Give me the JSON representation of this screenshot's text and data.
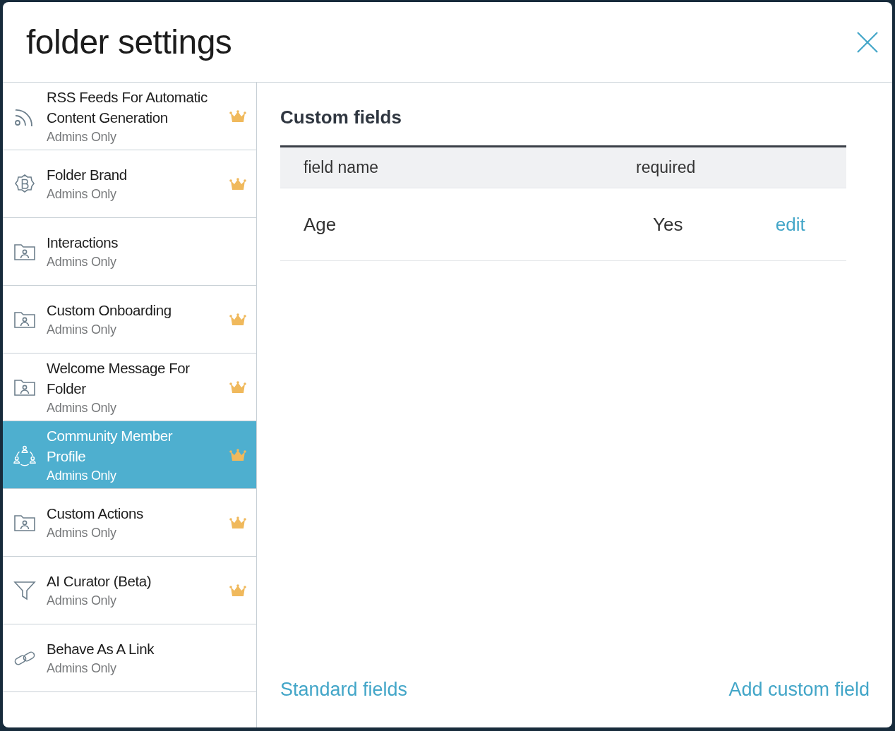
{
  "dialog": {
    "title": "folder settings"
  },
  "sidebar": {
    "items": [
      {
        "kind": "rss",
        "title": "RSS Feeds For Automatic Content Generation",
        "subtitle": "Admins Only",
        "premium": true,
        "selected": false
      },
      {
        "kind": "badge",
        "title": "Folder Brand",
        "subtitle": "Admins Only",
        "premium": true,
        "selected": false
      },
      {
        "kind": "folder-person",
        "title": "Interactions",
        "subtitle": "Admins Only",
        "premium": false,
        "selected": false
      },
      {
        "kind": "folder-person",
        "title": "Custom Onboarding",
        "subtitle": "Admins Only",
        "premium": true,
        "selected": false
      },
      {
        "kind": "folder-person",
        "title": "Welcome Message For Folder",
        "subtitle": "Admins Only",
        "premium": true,
        "selected": false
      },
      {
        "kind": "community",
        "title": "Community Member Profile",
        "subtitle": "Admins Only",
        "premium": true,
        "selected": true
      },
      {
        "kind": "folder-person",
        "title": "Custom Actions",
        "subtitle": "Admins Only",
        "premium": true,
        "selected": false
      },
      {
        "kind": "funnel",
        "title": "AI Curator (Beta)",
        "subtitle": "Admins Only",
        "premium": true,
        "selected": false
      },
      {
        "kind": "link",
        "title": "Behave As A Link",
        "subtitle": "Admins Only",
        "premium": false,
        "selected": false
      }
    ]
  },
  "content": {
    "heading": "Custom fields",
    "table": {
      "columns": [
        "field name",
        "required"
      ],
      "rows": [
        {
          "field_name": "Age",
          "required": "Yes",
          "action": "edit"
        }
      ]
    },
    "footer_links": [
      "Standard fields",
      "Add custom field"
    ]
  }
}
